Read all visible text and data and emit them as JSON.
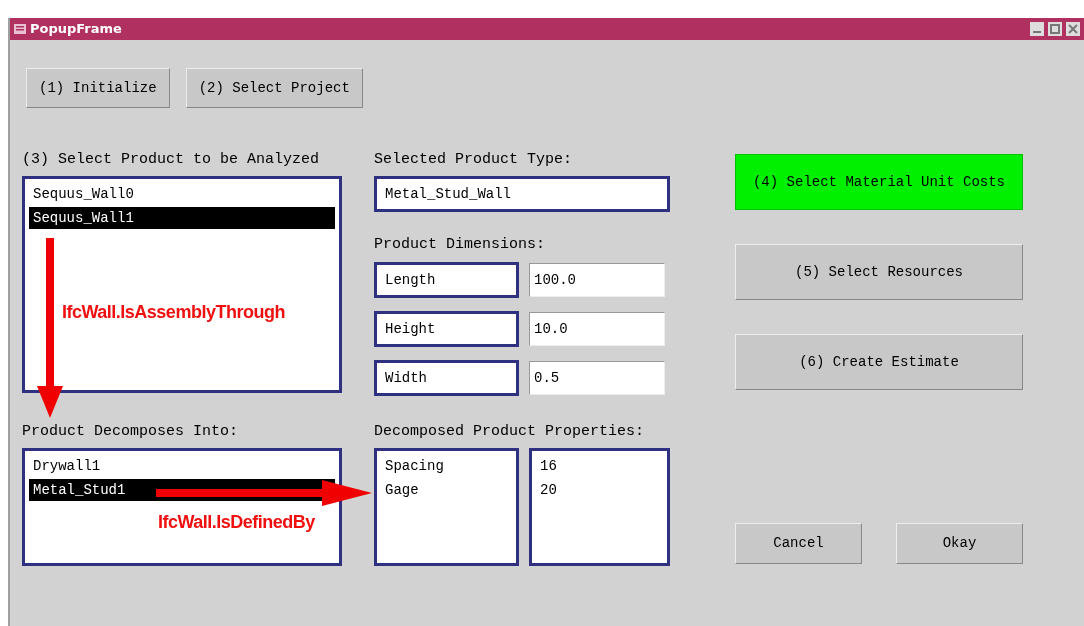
{
  "window": {
    "title": "PopupFrame"
  },
  "top_buttons": [
    "(1) Initialize",
    "(2) Select Project"
  ],
  "product_list": {
    "label": "(3) Select Product to be Analyzed",
    "items": [
      {
        "text": "Sequus_Wall0",
        "selected": false
      },
      {
        "text": "Sequus_Wall1",
        "selected": true
      }
    ]
  },
  "product_type": {
    "label": "Selected Product Type:",
    "value": "Metal_Stud_Wall"
  },
  "dimensions": {
    "label": "Product Dimensions:",
    "rows": [
      {
        "name": "Length",
        "value": "100.0"
      },
      {
        "name": "Height",
        "value": "10.0"
      },
      {
        "name": "Width",
        "value": "0.5"
      }
    ]
  },
  "decomposition": {
    "label": "Product Decomposes Into:",
    "items": [
      {
        "text": "Drywall1",
        "selected": false
      },
      {
        "text": "Metal_Stud1",
        "selected": true
      }
    ]
  },
  "properties": {
    "label": "Decomposed Product Properties:",
    "names": [
      "Spacing",
      "Gage"
    ],
    "values": [
      "16",
      "20"
    ]
  },
  "action_buttons": [
    {
      "label": "(4) Select Material Unit Costs",
      "highlighted": true
    },
    {
      "label": "(5) Select Resources",
      "highlighted": false
    },
    {
      "label": "(6) Create Estimate",
      "highlighted": false
    }
  ],
  "dialog_buttons": [
    "Cancel",
    "Okay"
  ],
  "annotations": [
    {
      "kind": "down",
      "text": "IfcWall.IsAssemblyThrough"
    },
    {
      "kind": "right",
      "text": "IfcWall.IsDefinedBy"
    }
  ]
}
